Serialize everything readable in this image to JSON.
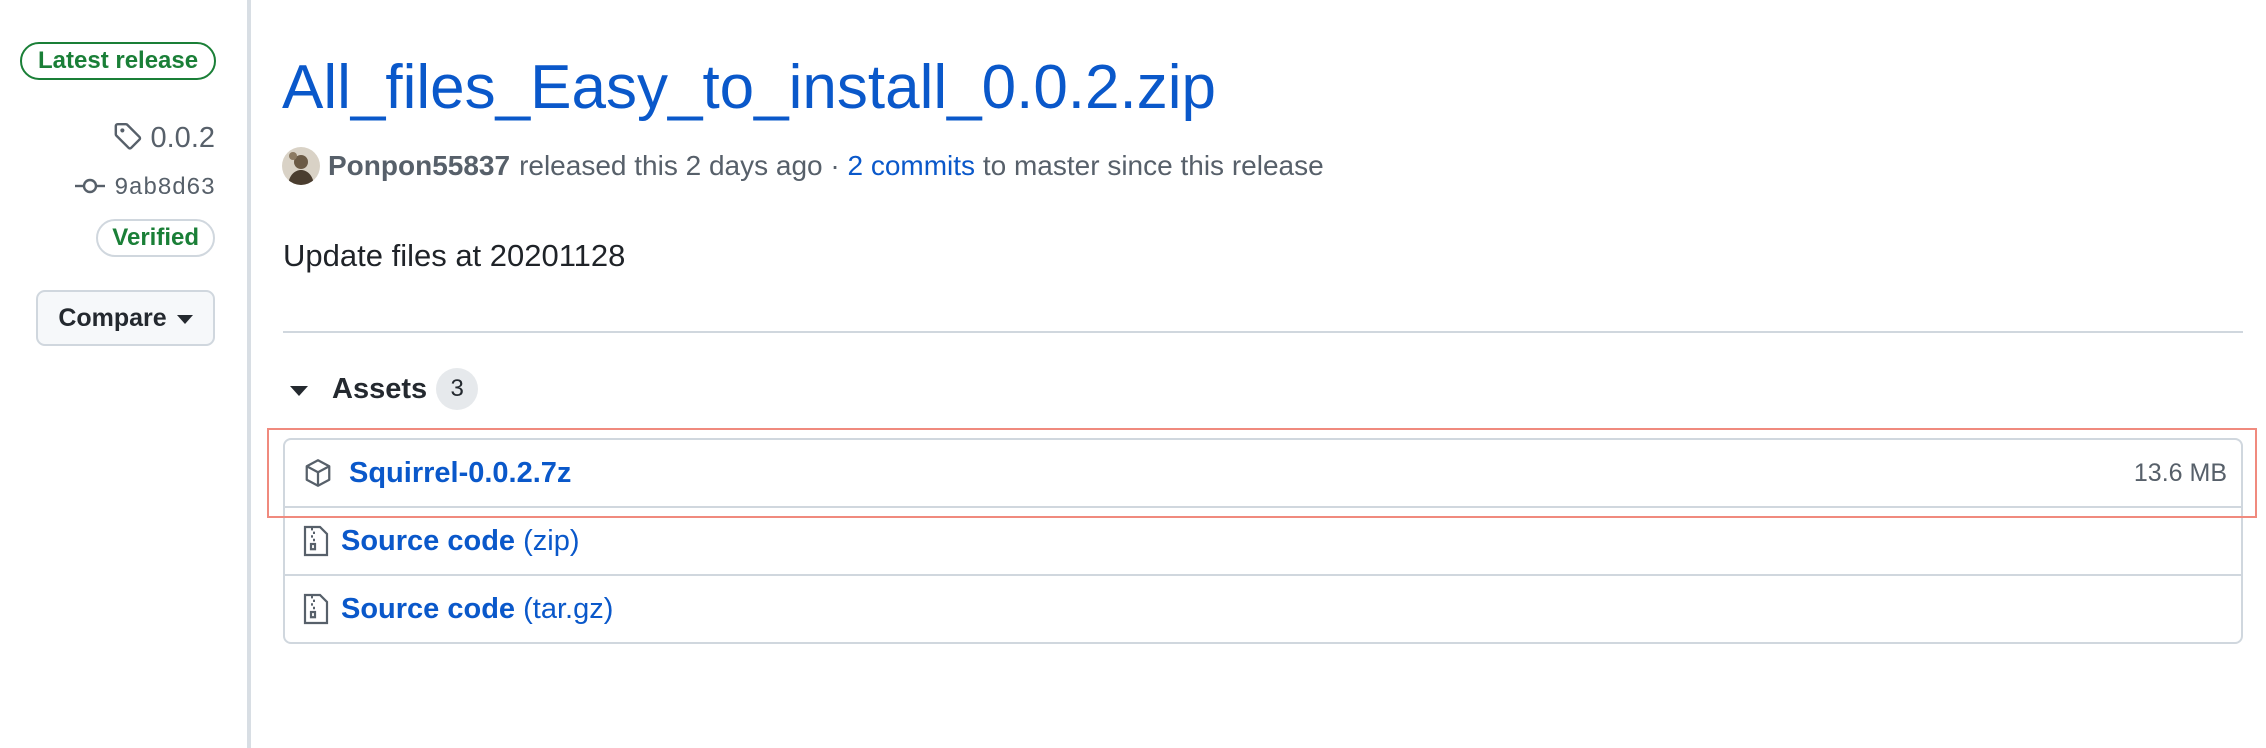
{
  "sidebar": {
    "latest_badge": "Latest release",
    "tag": "0.0.2",
    "commit": "9ab8d63",
    "verified_badge": "Verified",
    "compare_label": "Compare"
  },
  "release": {
    "title": "All_files_Easy_to_install_0.0.2.zip",
    "author": "Ponpon55837",
    "released_text": "released this 2 days ago ·",
    "commits_link": "2 commits",
    "commits_suffix": "to master since this release",
    "notes": "Update files at 20201128"
  },
  "assets": {
    "label": "Assets",
    "count": "3",
    "items": [
      {
        "name": "Squirrel-0.0.2.7z",
        "suffix": "",
        "size": "13.6 MB",
        "icon": "package-icon"
      },
      {
        "name": "Source code",
        "suffix": "(zip)",
        "size": "",
        "icon": "file-zip-icon"
      },
      {
        "name": "Source code",
        "suffix": "(tar.gz)",
        "size": "",
        "icon": "file-zip-icon"
      }
    ]
  },
  "colors": {
    "link": "#0a58ca",
    "success": "#1a7f37",
    "highlight": "#f08a7e"
  }
}
